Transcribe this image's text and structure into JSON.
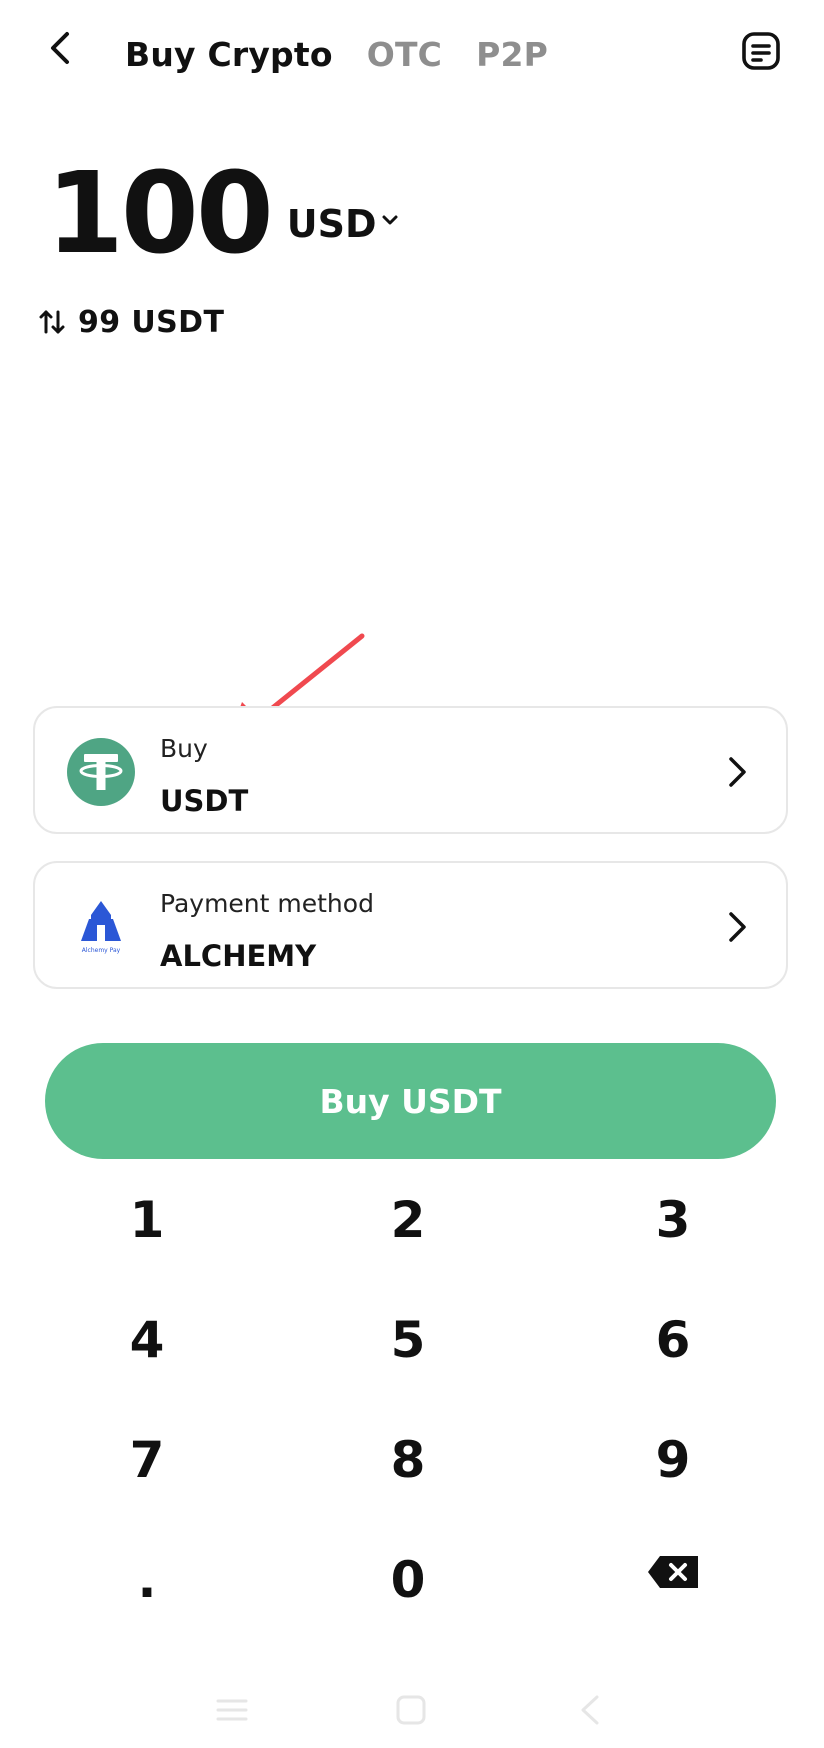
{
  "header": {
    "tabs": [
      {
        "label": "Buy Crypto",
        "active": true
      },
      {
        "label": "OTC",
        "active": false
      },
      {
        "label": "P2P",
        "active": false
      }
    ],
    "icons": {
      "back": "back-arrow-icon",
      "orders": "orders-list-icon"
    }
  },
  "amount": {
    "value": "100",
    "currency": "USD",
    "converted": "99 USDT",
    "icons": {
      "currency_dropdown": "chevron-down-icon",
      "swap": "swap-vertical-icon"
    }
  },
  "buy_card": {
    "label": "Buy",
    "value": "USDT",
    "icon": "tether-icon",
    "icon_color": "#4fa584"
  },
  "payment_card": {
    "label": "Payment method",
    "value": "ALCHEMY",
    "icon": "alchemy-pay-icon",
    "icon_caption": "Alchemy Pay",
    "icon_color": "#2b57d6"
  },
  "primary_button": {
    "label": "Buy USDT",
    "color": "#5cbf8e"
  },
  "keypad": {
    "keys": [
      "1",
      "2",
      "3",
      "4",
      "5",
      "6",
      "7",
      "8",
      "9",
      ".",
      "0"
    ],
    "backspace_icon": "backspace-icon"
  },
  "annotation": {
    "icon": "red-arrow-annotation",
    "color": "#f0494f"
  },
  "system_nav": {
    "icons": [
      "menu-icon",
      "home-square-icon",
      "back-triangle-icon"
    ]
  }
}
